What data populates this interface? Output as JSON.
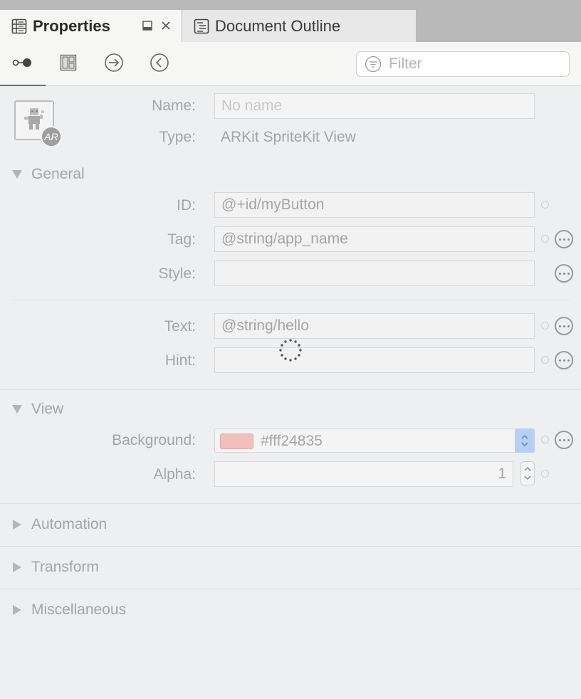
{
  "tabs": {
    "properties_label": "Properties",
    "outline_label": "Document Outline"
  },
  "toolbar": {
    "filter_placeholder": "Filter",
    "buttons": [
      "toggle-icon",
      "layout-icon",
      "arrow-right-circle-icon",
      "chevron-left-circle-icon"
    ]
  },
  "header": {
    "name_label": "Name:",
    "name_placeholder": "No name",
    "type_label": "Type:",
    "type_value": "ARKit SpriteKit View",
    "badge": "AR"
  },
  "general": {
    "title": "General",
    "id_label": "ID:",
    "id_value": "@+id/myButton",
    "tag_label": "Tag:",
    "tag_value": "@string/app_name",
    "style_label": "Style:",
    "style_value": "",
    "text_label": "Text:",
    "text_value": "@string/hello",
    "hint_label": "Hint:",
    "hint_value": ""
  },
  "view": {
    "title": "View",
    "background_label": "Background:",
    "background_value": "#fff24835",
    "background_swatch": "#f2c0bc",
    "alpha_label": "Alpha:",
    "alpha_value": "1"
  },
  "sections": {
    "automation": "Automation",
    "transform": "Transform",
    "miscellaneous": "Miscellaneous"
  },
  "colors": {
    "accent": "#b8cff3",
    "tab_active": "#f6f6f4",
    "panel_bg": "#eeeff1"
  }
}
